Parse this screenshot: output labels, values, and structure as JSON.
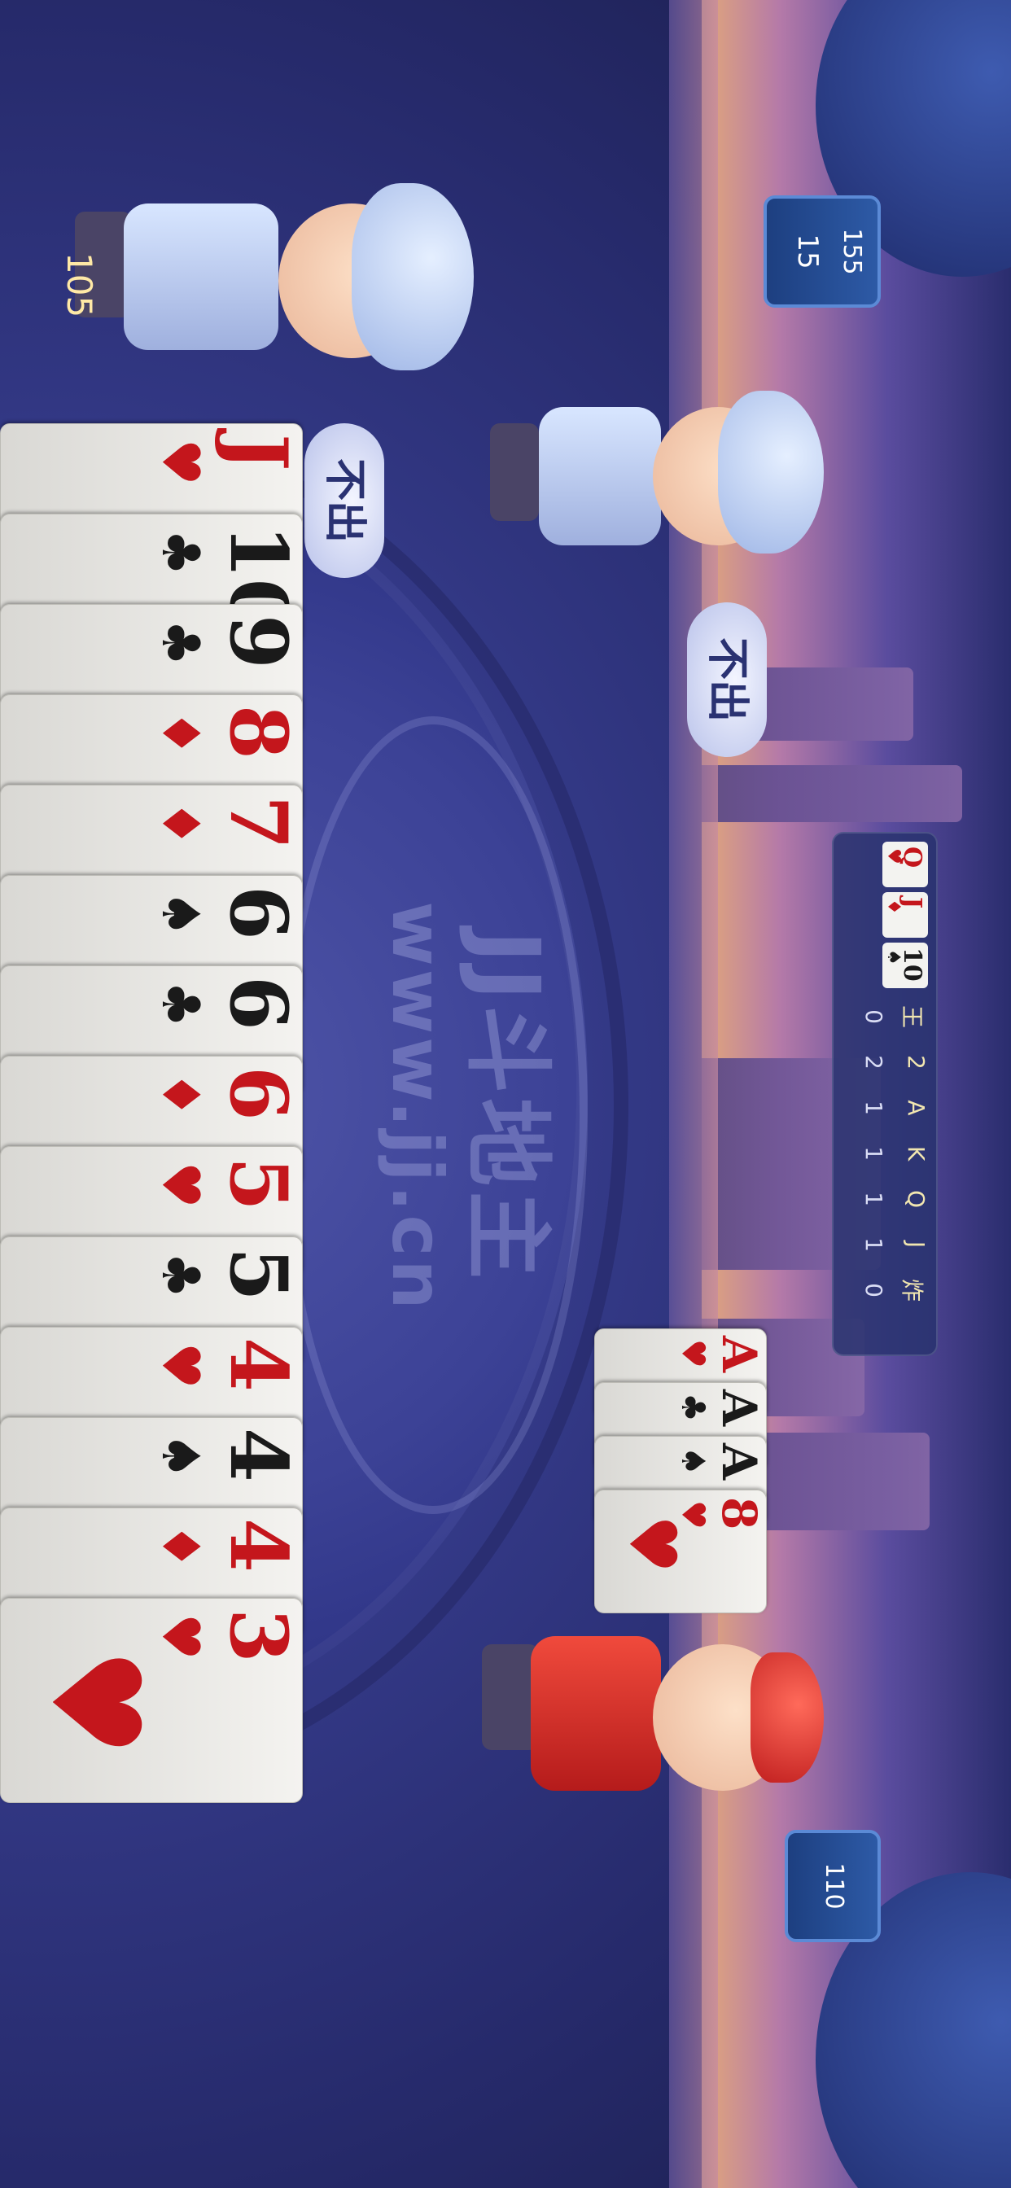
{
  "watermark": {
    "title": "JJ斗地主",
    "url": "www.jj.cn"
  },
  "scoreboard": {
    "recent_cards": [
      {
        "rank": "Q",
        "suit": "♥",
        "color": "red"
      },
      {
        "rank": "J",
        "suit": "♦",
        "color": "red"
      },
      {
        "rank": "10",
        "suit": "♠",
        "color": "black"
      }
    ],
    "headers": [
      "王",
      "2",
      "A",
      "K",
      "Q",
      "J",
      "炸"
    ],
    "counts": [
      "0",
      "2",
      "1",
      "1",
      "1",
      "1",
      "0"
    ]
  },
  "players": {
    "top": {
      "score": "155",
      "cards_left": "15",
      "status": "不出"
    },
    "bottom_left": {
      "score": "105",
      "status": "不出"
    },
    "right": {
      "score": "110"
    }
  },
  "played_cards": [
    {
      "rank": "A",
      "suit": "♥",
      "color": "red"
    },
    {
      "rank": "A",
      "suit": "♣",
      "color": "black"
    },
    {
      "rank": "A",
      "suit": "♠",
      "color": "black"
    },
    {
      "rank": "8",
      "suit": "♥",
      "color": "red"
    }
  ],
  "hand": [
    {
      "rank": "J",
      "suit": "♥",
      "color": "red"
    },
    {
      "rank": "10",
      "suit": "♣",
      "color": "black"
    },
    {
      "rank": "9",
      "suit": "♣",
      "color": "black"
    },
    {
      "rank": "8",
      "suit": "♦",
      "color": "red"
    },
    {
      "rank": "7",
      "suit": "♦",
      "color": "red"
    },
    {
      "rank": "6",
      "suit": "♠",
      "color": "black"
    },
    {
      "rank": "6",
      "suit": "♣",
      "color": "black"
    },
    {
      "rank": "6",
      "suit": "♦",
      "color": "red"
    },
    {
      "rank": "5",
      "suit": "♥",
      "color": "red"
    },
    {
      "rank": "5",
      "suit": "♣",
      "color": "black"
    },
    {
      "rank": "4",
      "suit": "♥",
      "color": "red"
    },
    {
      "rank": "4",
      "suit": "♠",
      "color": "black"
    },
    {
      "rank": "4",
      "suit": "♦",
      "color": "red"
    },
    {
      "rank": "3",
      "suit": "♥",
      "color": "red"
    }
  ],
  "colors": {
    "red": "#c4161c",
    "black": "#1a1a1a",
    "table": "#3c4296",
    "pill": "#2d5aa6"
  }
}
